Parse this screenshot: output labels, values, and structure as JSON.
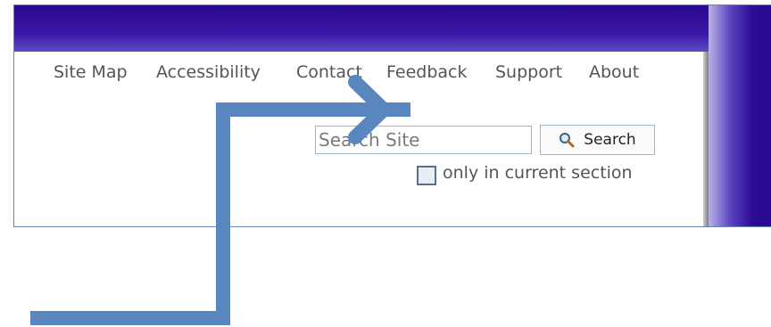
{
  "nav": {
    "items": [
      {
        "label": "Site Map"
      },
      {
        "label": "Accessibility"
      },
      {
        "label": "Contact"
      },
      {
        "label": "Feedback"
      },
      {
        "label": "Support"
      },
      {
        "label": "About"
      }
    ]
  },
  "search": {
    "placeholder": "Search Site",
    "button_label": "Search",
    "only_current_label": "only in current section",
    "only_current_checked": false
  },
  "colors": {
    "header_purple": "#2a0a8f",
    "arrow_blue": "#5a86c0",
    "link_gray": "#555555"
  },
  "icons": {
    "search_button_icon": "magnifier-icon",
    "annotation": "arrow-icon"
  }
}
